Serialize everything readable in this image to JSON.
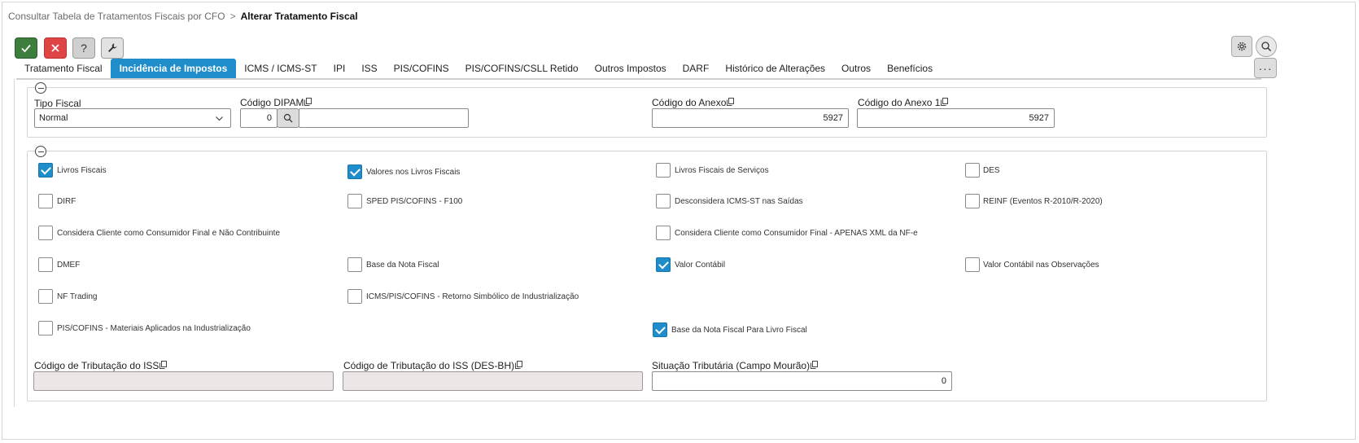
{
  "breadcrumb": {
    "parent": "Consultar Tabela de Tratamentos Fiscais por CFO",
    "separator": ">",
    "current": "Alterar Tratamento Fiscal"
  },
  "toolbar": {
    "help_label": "?"
  },
  "tabs": [
    "Tratamento Fiscal",
    "Incidência de Impostos",
    "ICMS / ICMS-ST",
    "IPI",
    "ISS",
    "PIS/COFINS",
    "PIS/COFINS/CSLL Retido",
    "Outros Impostos",
    "DARF",
    "Histórico de Alterações",
    "Outros",
    "Benefícios"
  ],
  "more_label": "···",
  "section1": {
    "tipo_fiscal_label": "Tipo Fiscal",
    "tipo_fiscal_value": "Normal",
    "dipam_label": "Código DIPAM",
    "dipam_value": "0",
    "dipam_desc": "",
    "anexo_label": "Código do Anexo",
    "anexo_value": "5927",
    "anexo1_label": "Código do Anexo 1",
    "anexo1_value": "5927"
  },
  "checkboxes": {
    "livros_fiscais": {
      "label": "Livros Fiscais",
      "checked": true
    },
    "valores_livros": {
      "label": "Valores nos Livros Fiscais",
      "checked": true
    },
    "livros_servicos": {
      "label": "Livros Fiscais de Serviços",
      "checked": false
    },
    "des": {
      "label": "DES",
      "checked": false
    },
    "dirf": {
      "label": "DIRF",
      "checked": false
    },
    "sped": {
      "label": "SPED PIS/COFINS - F100",
      "checked": false
    },
    "desconsidera": {
      "label": "Desconsidera ICMS-ST nas Saídas",
      "checked": false
    },
    "reinf": {
      "label": "REINF (Eventos R-2010/R-2020)",
      "checked": false
    },
    "consumidor_final": {
      "label": "Considera Cliente como Consumidor Final e Não Contribuinte",
      "checked": false
    },
    "consumidor_xml": {
      "label": "Considera Cliente como Consumidor Final - APENAS XML da NF-e",
      "checked": false
    },
    "dmef": {
      "label": "DMEF",
      "checked": false
    },
    "base_nota": {
      "label": "Base da Nota Fiscal",
      "checked": false
    },
    "valor_contabil": {
      "label": "Valor Contábil",
      "checked": true
    },
    "valor_contabil_obs": {
      "label": "Valor Contábil nas Observações",
      "checked": false
    },
    "nf_trading": {
      "label": "NF Trading",
      "checked": false
    },
    "retorno_simbolico": {
      "label": "ICMS/PIS/COFINS - Retorno Simbólico de Industrialização",
      "checked": false
    },
    "materiais": {
      "label": "PIS/COFINS - Materiais Aplicados na Industrialização",
      "checked": false
    },
    "base_livro": {
      "label": "Base da Nota Fiscal Para Livro Fiscal",
      "checked": true
    }
  },
  "section2_fields": {
    "iss_label": "Código de Tributação do ISS",
    "iss_value": "",
    "iss_bh_label": "Código de Tributação do ISS (DES-BH)",
    "iss_bh_value": "",
    "situacao_label": "Situação Tributária (Campo Mourão)",
    "situacao_value": "0"
  },
  "colors": {
    "accent": "#1f8dc9",
    "ok": "#3d7d3d",
    "cancel": "#e04545"
  }
}
